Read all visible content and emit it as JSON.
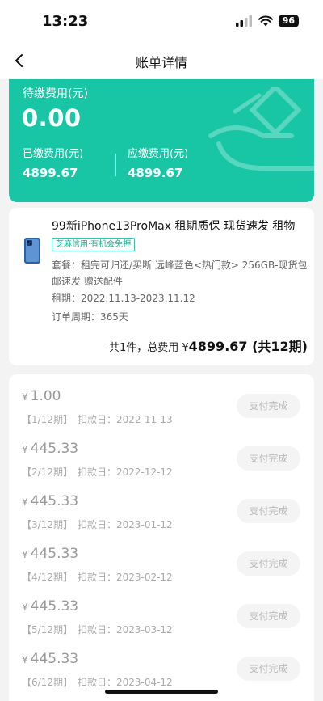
{
  "status": {
    "time": "13:23",
    "battery": "96"
  },
  "nav": {
    "title": "账单详情"
  },
  "summary": {
    "pending_label": "待缴费用(元)",
    "pending_value": "0.00",
    "paid_label": "已缴费用(元)",
    "paid_value": "4899.67",
    "due_label": "应缴费用(元)",
    "due_value": "4899.67"
  },
  "product": {
    "title": "99新iPhone13ProMax 租期质保 现货速发 租物",
    "badge": "芝麻信用·有机会免押",
    "spec": "套餐：租完可归还/买断 远峰蓝色<热门款> 256GB-现货包邮速发 赠送配件",
    "lease": "租期：2022.11.13-2023.11.12",
    "cycle": "订单周期：365天",
    "total_prefix": "共1件，总费用 ¥",
    "total_amount": "4899.67 (共12期)"
  },
  "installments": [
    {
      "amount": "1.00",
      "period": "【1/12期】",
      "date": "扣款日：2022-11-13",
      "status": "支付完成"
    },
    {
      "amount": "445.33",
      "period": "【2/12期】",
      "date": "扣款日：2022-12-12",
      "status": "支付完成"
    },
    {
      "amount": "445.33",
      "period": "【3/12期】",
      "date": "扣款日：2023-01-12",
      "status": "支付完成"
    },
    {
      "amount": "445.33",
      "period": "【4/12期】",
      "date": "扣款日：2023-02-12",
      "status": "支付完成"
    },
    {
      "amount": "445.33",
      "period": "【5/12期】",
      "date": "扣款日：2023-03-12",
      "status": "支付完成"
    },
    {
      "amount": "445.33",
      "period": "【6/12期】",
      "date": "扣款日：2023-04-12",
      "status": "支付完成"
    }
  ],
  "currency_symbol": "¥",
  "colors": {
    "accent": "#18c6a6",
    "badge": "#13b596"
  },
  "icons": [
    "signal-icon",
    "wifi-icon",
    "chevron-left-icon",
    "phone-thumbnail-icon"
  ]
}
